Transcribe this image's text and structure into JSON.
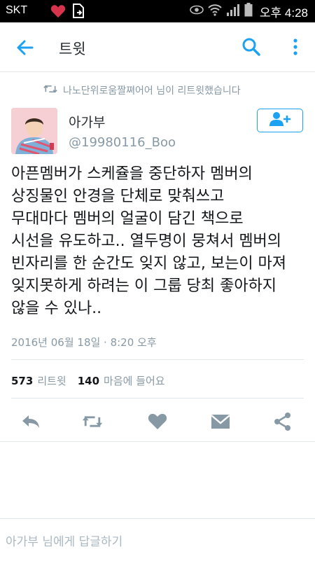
{
  "status_bar": {
    "carrier": "SKT",
    "time": "오후 4:28"
  },
  "app_bar": {
    "title": "트윗",
    "back_icon": "arrow-left-icon",
    "search_icon": "search-icon",
    "more_icon": "more-vertical-icon"
  },
  "retweet_context": {
    "text": "나노단위로움짤쪄어어 님이 리트윗했습니다"
  },
  "tweet": {
    "author_name": "아가부",
    "author_handle": "@19980116_Boo",
    "text_lines": [
      "아픈멤버가 스케쥴을 중단하자 멤버의",
      "상징물인 안경을 단체로 맞춰쓰고",
      "무대마다 멤버의 얼굴이 담긴 책으로",
      "시선을 유도하고.. 열두명이 뭉쳐서 멤버의",
      "빈자리를 한 순간도 잊지 않고, 보는이 마져",
      "잊지못하게 하려는 이 그룹 당최 좋아하지",
      "않을 수 있나.."
    ],
    "timestamp": "2016년 06월 18일 · 8:20 오후",
    "retweet_count": "573",
    "retweet_label": "리트윗",
    "like_count": "140",
    "like_label": "마음에 들어요"
  },
  "reply": {
    "placeholder": "아가부 님에게 답글하기"
  },
  "colors": {
    "accent": "#1da1f2",
    "icon_gray": "#8899a6"
  }
}
